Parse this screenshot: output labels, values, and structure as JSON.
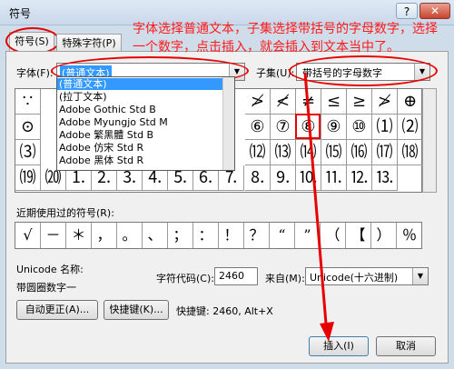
{
  "window": {
    "title": "符号",
    "help": "?",
    "close": "✕"
  },
  "tabs": [
    {
      "label": "符号(S)"
    },
    {
      "label": "特殊字符(P)"
    }
  ],
  "annotation": "字体选择普通文本，子集选择带括号的字母数字，选择一个数字，点击插入，就会插入到文本当中了。",
  "font": {
    "label": "字体(F):",
    "value": "(普通文本)"
  },
  "subset": {
    "label": "子集(U):",
    "value": "带括号的字母数字"
  },
  "font_dropdown": [
    {
      "label": "(普通文本)",
      "selected": true
    },
    {
      "label": "(拉丁文本)"
    },
    {
      "label": "Adobe Gothic Std B"
    },
    {
      "label": "Adobe Myungjo Std M"
    },
    {
      "label": "Adobe 繁黑體 Std B"
    },
    {
      "label": "Adobe 仿宋 Std R"
    },
    {
      "label": "Adobe 黑体 Std R"
    }
  ],
  "grid_rows": [
    [
      "∵",
      "≯",
      "≮",
      "≠",
      "≤",
      "≥",
      "≤",
      "≥",
      "≮",
      "≯",
      "⊕"
    ],
    [
      "⊙",
      "⑥",
      "⑦",
      "⑧",
      "⑨",
      "⑩",
      "⑴",
      "⑵"
    ],
    [
      "⑶",
      "⑿",
      "⒀",
      "⒁",
      "⒂",
      "⒃",
      "⒄",
      "⒅"
    ],
    [
      "⒆",
      "⒇",
      "⒈",
      "⒉",
      "⒊",
      "⒋",
      "⒌",
      "⒍",
      "⒎",
      "⒏",
      "⒐",
      "⒑",
      "⒒",
      "⒓",
      "⒔"
    ]
  ],
  "recent_label": "近期使用过的符号(R):",
  "recent": [
    "√",
    "－",
    "＊",
    "，",
    "。",
    "、",
    "；",
    "：",
    "！",
    "？",
    "“",
    "”",
    "（",
    "【",
    "）",
    "％"
  ],
  "unicode_name_label": "Unicode 名称:",
  "unicode_name_value": "带圆圈数字一",
  "charcode_label": "字符代码(C):",
  "charcode_value": "2460",
  "from_label": "来自(M):",
  "from_value": "Unicode(十六进制)",
  "autocorrect_button": "自动更正(A)...",
  "shortcut_button": "快捷键(K)...",
  "shortcut_text": "快捷键: 2460, Alt+X",
  "insert_button": "插入(I)",
  "cancel_button": "取消",
  "colors": {
    "annotation": "#ff1a1a",
    "selection": "#3399ff"
  }
}
